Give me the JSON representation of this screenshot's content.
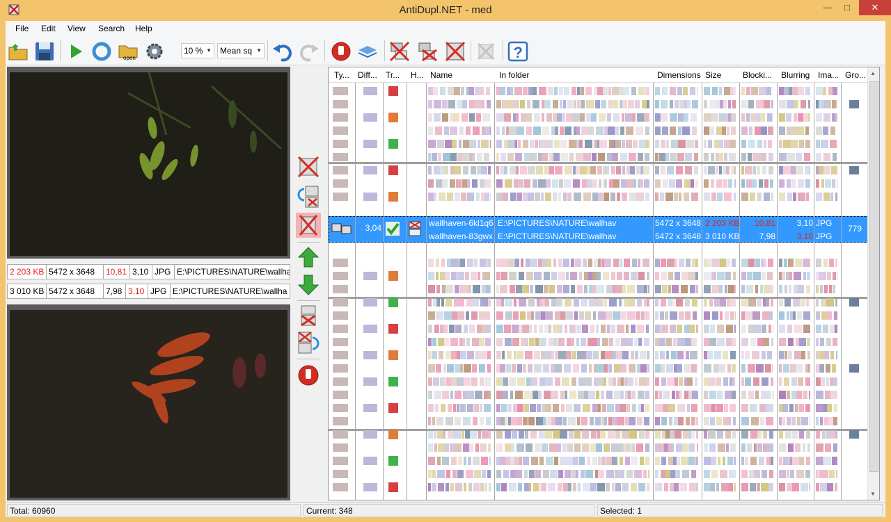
{
  "window": {
    "title": "AntiDupl.NET - med",
    "min": "—",
    "max": "□",
    "close": "✕"
  },
  "menu": [
    "File",
    "Edit",
    "View",
    "Search",
    "Help"
  ],
  "toolbar": {
    "open_icon_label": "open",
    "zoom": "10 %",
    "algorithm": "Mean sq"
  },
  "left": {
    "first": {
      "size": "2 203 KB",
      "dims": "5472 x 3648",
      "blocking": "10,81",
      "blurring": "3,10",
      "type": "JPG",
      "path": "E:\\PICTURES\\NATURE\\wallha"
    },
    "second": {
      "size": "3 010 KB",
      "dims": "5472 x 3648",
      "blocking": "7,98",
      "blurring": "3,10",
      "type": "JPG",
      "path": "E:\\PICTURES\\NATURE\\wallha"
    }
  },
  "grid": {
    "columns": [
      "Ty...",
      "Diff...",
      "Tr...",
      "H...",
      "Name",
      "In folder",
      "Dimensions",
      "Size",
      "Blocki...",
      "Blurring",
      "Ima...",
      "Gro..."
    ],
    "selected": {
      "difference": "3,04",
      "group": "779",
      "rows": [
        {
          "name": "wallhaven-6kl1q6...",
          "folder": "E:\\PICTURES\\NATURE\\wallhav",
          "dims": "5472 x 3648",
          "size": "2 203 KB",
          "blocking": "10,81",
          "blurring": "3,10",
          "type": "JPG"
        },
        {
          "name": "wallhaven-83gwx...",
          "folder": "E:\\PICTURES\\NATURE\\wallhav",
          "dims": "5472 x 3648",
          "size": "3 010 KB",
          "blocking": "7,98",
          "blurring": "3,10",
          "type": "JPG"
        }
      ]
    }
  },
  "status": {
    "total": "Total: 60960",
    "current": "Current: 348",
    "selected": "Selected: 1"
  },
  "colors": {
    "title_bar": "#f3c46b",
    "close_button": "#c7413a",
    "selection": "#3399ff",
    "highlight_red": "#e0231c"
  }
}
